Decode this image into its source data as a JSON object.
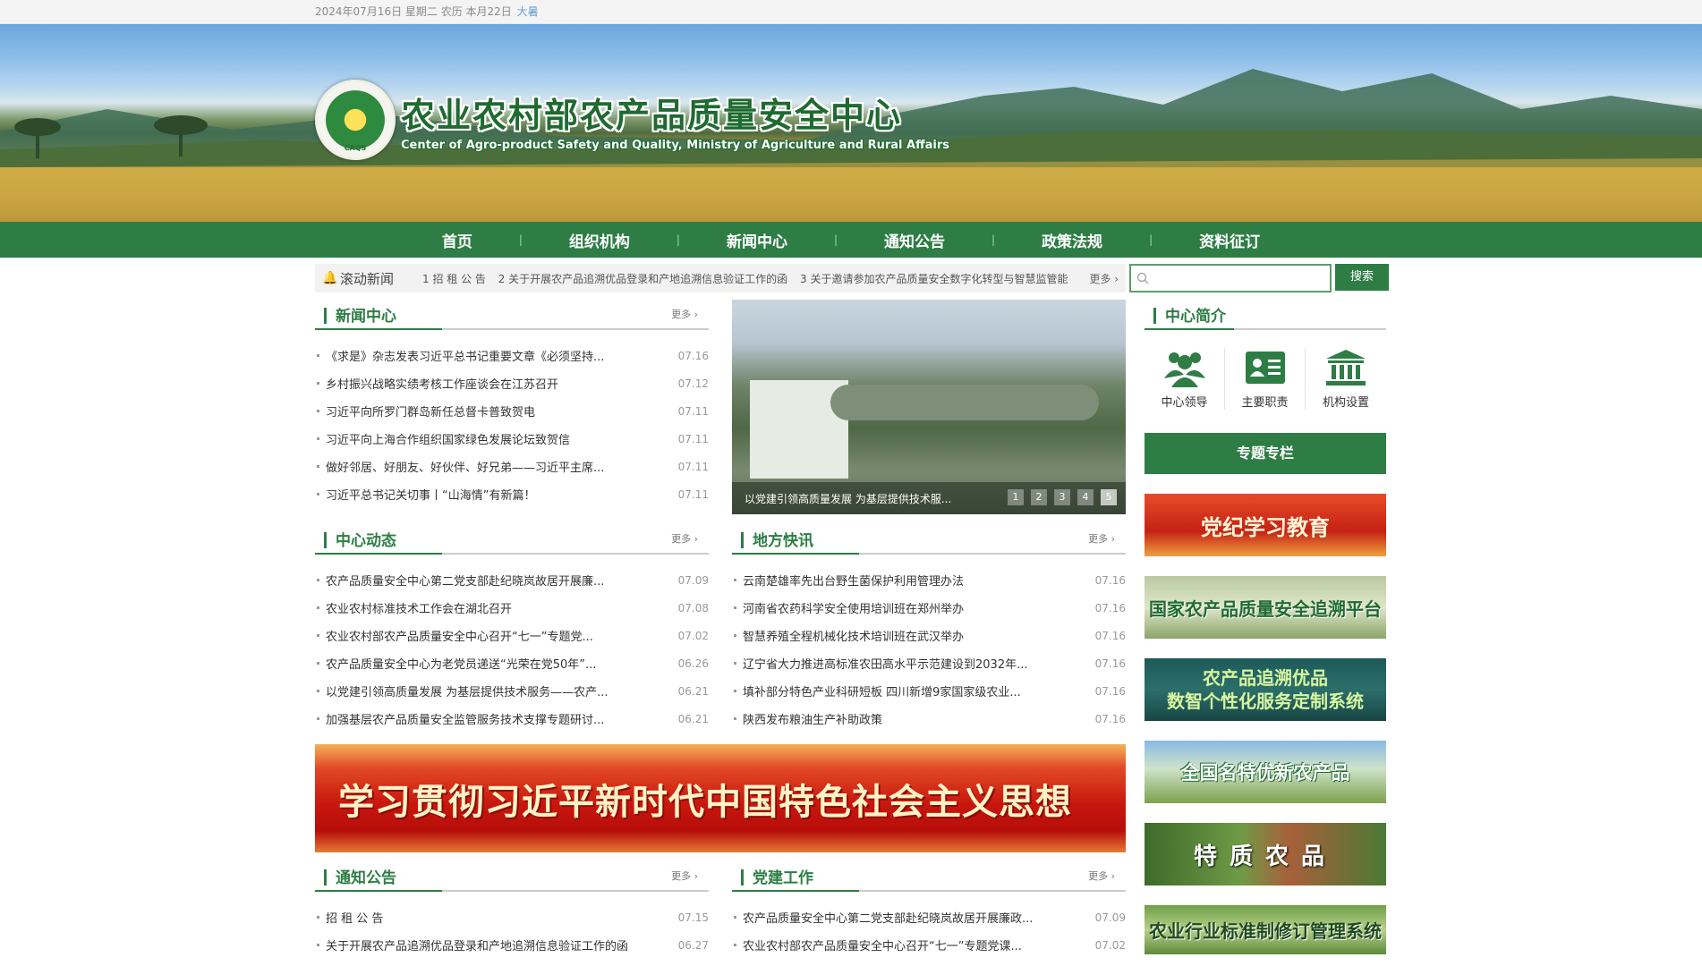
{
  "topbar": {
    "date_text": "2024年07月16日 星期二 农历 本月22日",
    "weather": "大暑"
  },
  "site": {
    "title_cn": "农业农村部农产品质量安全中心",
    "title_en": "Center of Agro-product Safety and Quality, Ministry of Agriculture and Rural Affairs"
  },
  "nav": {
    "items": [
      "首页",
      "组织机构",
      "新闻中心",
      "通知公告",
      "政策法规",
      "资料征订"
    ],
    "sep": "|"
  },
  "ticker": {
    "title": "滚动新闻",
    "items": [
      "1 招 租 公 告",
      "2 关于开展农产品追溯优品登录和产地追溯信息验证工作的函",
      "3 关于邀请参加农产品质量安全数字化转型与智慧监管能"
    ],
    "more": "更多"
  },
  "search": {
    "button": "搜索"
  },
  "news_center": {
    "title": "新闻中心",
    "more": "更多 ›",
    "items": [
      {
        "t": "《求是》杂志发表习近平总书记重要文章《必须坚持...",
        "d": "07.16"
      },
      {
        "t": "乡村振兴战略实绩考核工作座谈会在江苏召开",
        "d": "07.12"
      },
      {
        "t": "习近平向所罗门群岛新任总督卡普致贺电",
        "d": "07.11"
      },
      {
        "t": "习近平向上海合作组织国家绿色发展论坛致贺信",
        "d": "07.11"
      },
      {
        "t": "做好邻居、好朋友、好伙伴、好兄弟——习近平主席...",
        "d": "07.11"
      },
      {
        "t": "习近平总书记关切事丨“山海情”有新篇！",
        "d": "07.11"
      }
    ]
  },
  "carousel": {
    "caption": "以党建引领高质量发展 为基层提供技术服...",
    "dots": [
      "1",
      "2",
      "3",
      "4",
      "5"
    ]
  },
  "center_news": {
    "title": "中心动态",
    "more": "更多 ›",
    "items": [
      {
        "t": "农产品质量安全中心第二党支部赴纪晓岚故居开展廉...",
        "d": "07.09"
      },
      {
        "t": "农业农村标准技术工作会在湖北召开",
        "d": "07.08"
      },
      {
        "t": "农业农村部农产品质量安全中心召开“七一”专题党...",
        "d": "07.02"
      },
      {
        "t": "农产品质量安全中心为老党员递送“光荣在党50年”...",
        "d": "06.26"
      },
      {
        "t": "以党建引领高质量发展 为基层提供技术服务——农产...",
        "d": "06.21"
      },
      {
        "t": "加强基层农产品质量安全监管服务技术支撑专题研讨...",
        "d": "06.21"
      }
    ]
  },
  "local_news": {
    "title": "地方快讯",
    "more": "更多 ›",
    "items": [
      {
        "t": "云南楚雄率先出台野生菌保护利用管理办法",
        "d": "07.16"
      },
      {
        "t": "河南省农药科学安全使用培训班在郑州举办",
        "d": "07.16"
      },
      {
        "t": "智慧养殖全程机械化技术培训班在武汉举办",
        "d": "07.16"
      },
      {
        "t": "辽宁省大力推进高标准农田高水平示范建设到2032年...",
        "d": "07.16"
      },
      {
        "t": "填补部分特色产业科研短板 四川新增9家国家级农业...",
        "d": "07.16"
      },
      {
        "t": "陕西发布粮油生产补助政策",
        "d": "07.16"
      }
    ]
  },
  "red_banner": {
    "text": "学习贯彻习近平新时代中国特色社会主义思想"
  },
  "notices": {
    "title": "通知公告",
    "more": "更多 ›",
    "items": [
      {
        "t": "招 租 公 告",
        "d": "07.15"
      },
      {
        "t": "关于开展农产品追溯优品登录和产地追溯信息验证工作的函",
        "d": "06.27"
      }
    ]
  },
  "party_work": {
    "title": "党建工作",
    "more": "更多 ›",
    "items": [
      {
        "t": "农产品质量安全中心第二党支部赴纪晓岚故居开展廉政...",
        "d": "07.09"
      },
      {
        "t": "农业农村部农产品质量安全中心召开“七一”专题党课...",
        "d": "07.02"
      }
    ]
  },
  "intro": {
    "title": "中心简介",
    "icons": [
      {
        "label": "中心领导",
        "icon": "people-icon"
      },
      {
        "label": "主要职责",
        "icon": "id-card-icon"
      },
      {
        "label": "机构设置",
        "icon": "building-icon"
      }
    ]
  },
  "special": {
    "title": "专题专栏",
    "items": [
      "党纪学习教育",
      "国家农产品质量安全追溯平台",
      "农产品追溯优品\n数智个性化服务定制系统",
      "全国名特优新农产品",
      "特质农品",
      "农业行业标准制修订管理系统"
    ]
  },
  "colors": {
    "brand_green": "#2e7d45",
    "banner_red": "#c8170e"
  }
}
